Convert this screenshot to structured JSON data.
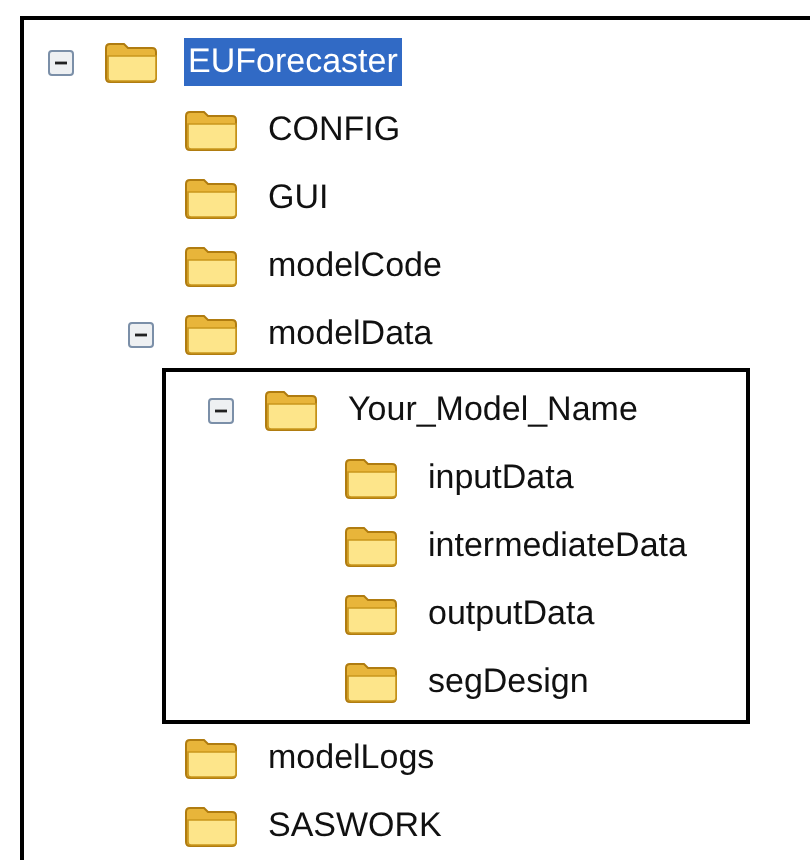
{
  "tree": [
    {
      "label": "EUForecaster",
      "selected": true,
      "expanded": true,
      "children": [
        {
          "label": "CONFIG",
          "selected": false
        },
        {
          "label": "GUI",
          "selected": false
        },
        {
          "label": "modelCode",
          "selected": false
        },
        {
          "label": "modelData",
          "selected": false,
          "expanded": true,
          "children": [
            {
              "label": "Your_Model_Name",
              "selected": false,
              "expanded": true,
              "highlighted": true,
              "children": [
                {
                  "label": "inputData",
                  "selected": false
                },
                {
                  "label": "intermediateData",
                  "selected": false
                },
                {
                  "label": "outputData",
                  "selected": false
                },
                {
                  "label": "segDesign",
                  "selected": false
                }
              ]
            }
          ]
        },
        {
          "label": "modelLogs",
          "selected": false
        },
        {
          "label": "SASWORK",
          "selected": false
        }
      ]
    }
  ]
}
